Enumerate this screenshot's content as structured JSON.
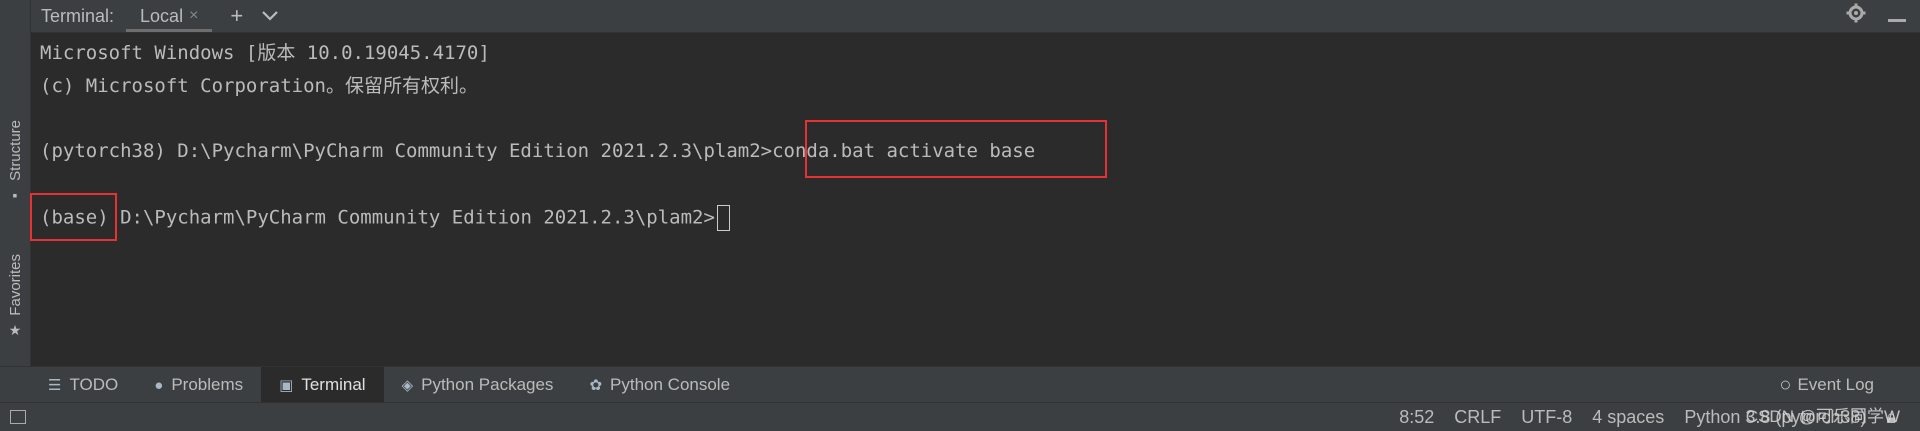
{
  "left_strip": {
    "structure_label": "Structure",
    "favorites_label": "Favorites"
  },
  "header": {
    "title": "Terminal:",
    "tab_label": "Local",
    "close_glyph": "×",
    "add_glyph": "+",
    "dropdown_glyph": "⌄",
    "settings_icon": "gear-icon",
    "minimize_icon": "minimize-icon"
  },
  "terminal": {
    "lines": [
      "Microsoft Windows [版本 10.0.19045.4170]",
      "(c) Microsoft Corporation。保留所有权利。",
      "(pytorch38) D:\\Pycharm\\PyCharm Community Edition 2021.2.3\\plam2>",
      "conda.bat activate base",
      "(base)",
      " D:\\Pycharm\\PyCharm Community Edition 2021.2.3\\plam2>"
    ],
    "highlight_color": "#e53333"
  },
  "toolbar": {
    "items": [
      {
        "label": "TODO",
        "icon": "list-icon"
      },
      {
        "label": "Problems",
        "icon": "info-icon"
      },
      {
        "label": "Terminal",
        "icon": "terminal-icon",
        "active": true
      },
      {
        "label": "Python Packages",
        "icon": "layers-icon"
      },
      {
        "label": "Python Console",
        "icon": "python-icon"
      }
    ],
    "event_log": "Event Log"
  },
  "statusbar": {
    "position": "8:52",
    "line_sep": "CRLF",
    "encoding": "UTF-8",
    "indent": "4 spaces",
    "interpreter": "Python 3.8 (pytorch38)"
  },
  "watermark": "CSDN @可乐同学W"
}
